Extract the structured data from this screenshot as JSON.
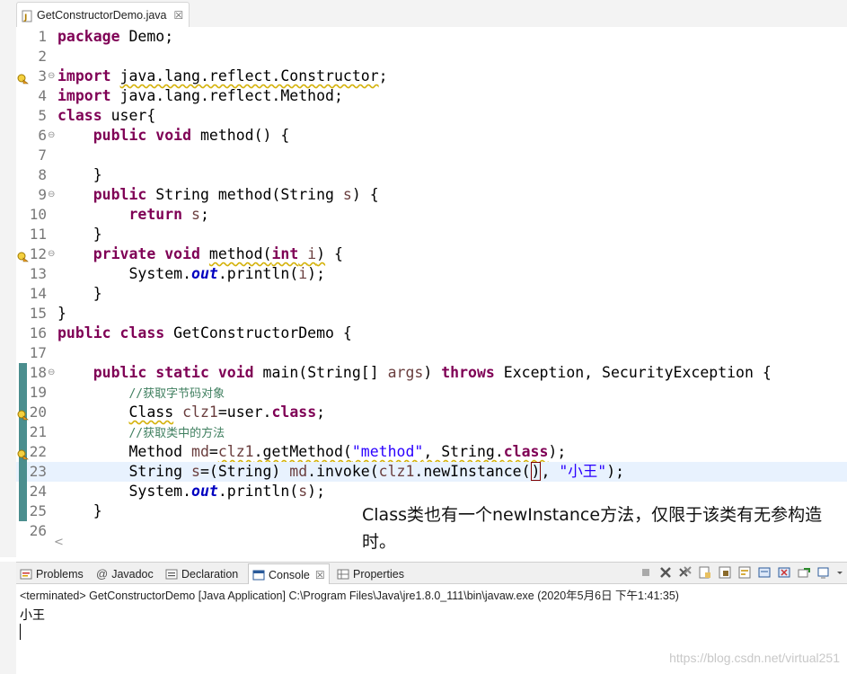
{
  "editor_tab": {
    "label": "GetConstructorDemo.java",
    "close": "☒"
  },
  "lines": [
    {
      "n": "1",
      "fold": "",
      "mark": "",
      "cur": false,
      "tokens": [
        {
          "c": "kw",
          "t": "package"
        },
        {
          "c": "",
          "t": " Demo;"
        }
      ]
    },
    {
      "n": "2",
      "fold": "",
      "mark": "",
      "cur": false,
      "tokens": []
    },
    {
      "n": "3",
      "fold": "⊖",
      "mark": "bulb",
      "cur": false,
      "tokens": [
        {
          "c": "kw",
          "t": "import"
        },
        {
          "c": "",
          "t": " "
        },
        {
          "c": "warn",
          "t": "java.lang.reflect.Constructor"
        },
        {
          "c": "",
          "t": ";"
        }
      ]
    },
    {
      "n": "4",
      "fold": "",
      "mark": "",
      "cur": false,
      "tokens": [
        {
          "c": "kw",
          "t": "import"
        },
        {
          "c": "",
          "t": " java.lang.reflect.Method;"
        }
      ]
    },
    {
      "n": "5",
      "fold": "",
      "mark": "",
      "cur": false,
      "tokens": [
        {
          "c": "kw",
          "t": "class"
        },
        {
          "c": "",
          "t": " user{"
        }
      ]
    },
    {
      "n": "6",
      "fold": "⊖",
      "mark": "",
      "cur": false,
      "tokens": [
        {
          "c": "",
          "t": "    "
        },
        {
          "c": "kw",
          "t": "public"
        },
        {
          "c": "",
          "t": " "
        },
        {
          "c": "kw",
          "t": "void"
        },
        {
          "c": "",
          "t": " method() {"
        }
      ]
    },
    {
      "n": "7",
      "fold": "",
      "mark": "",
      "cur": false,
      "tokens": []
    },
    {
      "n": "8",
      "fold": "",
      "mark": "",
      "cur": false,
      "tokens": [
        {
          "c": "",
          "t": "    }"
        }
      ]
    },
    {
      "n": "9",
      "fold": "⊖",
      "mark": "",
      "cur": false,
      "tokens": [
        {
          "c": "",
          "t": "    "
        },
        {
          "c": "kw",
          "t": "public"
        },
        {
          "c": "",
          "t": " String method(String "
        },
        {
          "c": "var",
          "t": "s"
        },
        {
          "c": "",
          "t": ") {"
        }
      ]
    },
    {
      "n": "10",
      "fold": "",
      "mark": "",
      "cur": false,
      "tokens": [
        {
          "c": "",
          "t": "        "
        },
        {
          "c": "kw",
          "t": "return"
        },
        {
          "c": "",
          "t": " "
        },
        {
          "c": "var",
          "t": "s"
        },
        {
          "c": "",
          "t": ";"
        }
      ]
    },
    {
      "n": "11",
      "fold": "",
      "mark": "",
      "cur": false,
      "tokens": [
        {
          "c": "",
          "t": "    }"
        }
      ]
    },
    {
      "n": "12",
      "fold": "⊖",
      "mark": "bulb",
      "cur": false,
      "tokens": [
        {
          "c": "",
          "t": "    "
        },
        {
          "c": "kw",
          "t": "private"
        },
        {
          "c": "",
          "t": " "
        },
        {
          "c": "kw",
          "t": "void"
        },
        {
          "c": "",
          "t": " "
        },
        {
          "c": "warn",
          "t": "method("
        },
        {
          "c": "kw warn",
          "t": "int"
        },
        {
          "c": "warn",
          "t": " "
        },
        {
          "c": "var warn",
          "t": "i"
        },
        {
          "c": "warn",
          "t": ")"
        },
        {
          "c": "",
          "t": " {"
        }
      ]
    },
    {
      "n": "13",
      "fold": "",
      "mark": "",
      "cur": false,
      "tokens": [
        {
          "c": "",
          "t": "        System."
        },
        {
          "c": "fld",
          "t": "out"
        },
        {
          "c": "",
          "t": ".println("
        },
        {
          "c": "var",
          "t": "i"
        },
        {
          "c": "",
          "t": ");"
        }
      ]
    },
    {
      "n": "14",
      "fold": "",
      "mark": "",
      "cur": false,
      "tokens": [
        {
          "c": "",
          "t": "    }"
        }
      ]
    },
    {
      "n": "15",
      "fold": "",
      "mark": "",
      "cur": false,
      "tokens": [
        {
          "c": "",
          "t": "}"
        }
      ]
    },
    {
      "n": "16",
      "fold": "",
      "mark": "",
      "cur": false,
      "tokens": [
        {
          "c": "kw",
          "t": "public"
        },
        {
          "c": "",
          "t": " "
        },
        {
          "c": "kw",
          "t": "class"
        },
        {
          "c": "",
          "t": " GetConstructorDemo {"
        }
      ]
    },
    {
      "n": "17",
      "fold": "",
      "mark": "",
      "cur": false,
      "tokens": []
    },
    {
      "n": "18",
      "fold": "⊖",
      "mark": "teal",
      "cur": false,
      "tokens": [
        {
          "c": "",
          "t": "    "
        },
        {
          "c": "kw",
          "t": "public"
        },
        {
          "c": "",
          "t": " "
        },
        {
          "c": "kw",
          "t": "static"
        },
        {
          "c": "",
          "t": " "
        },
        {
          "c": "kw",
          "t": "void"
        },
        {
          "c": "",
          "t": " main(String[] "
        },
        {
          "c": "var",
          "t": "args"
        },
        {
          "c": "",
          "t": ") "
        },
        {
          "c": "kw",
          "t": "throws"
        },
        {
          "c": "",
          "t": " Exception, SecurityException {"
        }
      ]
    },
    {
      "n": "19",
      "fold": "",
      "mark": "teal",
      "cur": false,
      "tokens": [
        {
          "c": "",
          "t": "        "
        },
        {
          "c": "cm",
          "t": "//获取字节码对象"
        }
      ]
    },
    {
      "n": "20",
      "fold": "",
      "mark": "teal bulb",
      "cur": false,
      "tokens": [
        {
          "c": "",
          "t": "        "
        },
        {
          "c": "warn",
          "t": "Class"
        },
        {
          "c": "",
          "t": " "
        },
        {
          "c": "var",
          "t": "clz1"
        },
        {
          "c": "",
          "t": "=user."
        },
        {
          "c": "kw",
          "t": "class"
        },
        {
          "c": "",
          "t": ";"
        }
      ]
    },
    {
      "n": "21",
      "fold": "",
      "mark": "teal",
      "cur": false,
      "tokens": [
        {
          "c": "",
          "t": "        "
        },
        {
          "c": "cm",
          "t": "//获取类中的方法"
        }
      ]
    },
    {
      "n": "22",
      "fold": "",
      "mark": "teal bulb",
      "cur": false,
      "tokens": [
        {
          "c": "",
          "t": "        Method "
        },
        {
          "c": "var",
          "t": "md"
        },
        {
          "c": "",
          "t": "="
        },
        {
          "c": "var warn",
          "t": "clz1"
        },
        {
          "c": "warn",
          "t": ".getMethod("
        },
        {
          "c": "str warn",
          "t": "\"method\""
        },
        {
          "c": "warn",
          "t": ", String."
        },
        {
          "c": "kw warn",
          "t": "class"
        },
        {
          "c": "",
          "t": ");"
        }
      ]
    },
    {
      "n": "23",
      "fold": "",
      "mark": "teal",
      "cur": true,
      "tokens": [
        {
          "c": "",
          "t": "        String "
        },
        {
          "c": "var",
          "t": "s"
        },
        {
          "c": "",
          "t": "=(String) "
        },
        {
          "c": "var",
          "t": "md"
        },
        {
          "c": "",
          "t": ".invoke("
        },
        {
          "c": "var",
          "t": "clz1"
        },
        {
          "c": "",
          "t": ".newInstance("
        },
        {
          "c": "caret-box",
          "t": ")"
        },
        {
          "c": "",
          "t": ", "
        },
        {
          "c": "str",
          "t": "\"小王\""
        },
        {
          "c": "",
          "t": ");"
        }
      ]
    },
    {
      "n": "24",
      "fold": "",
      "mark": "teal",
      "cur": false,
      "tokens": [
        {
          "c": "",
          "t": "        System."
        },
        {
          "c": "fld",
          "t": "out"
        },
        {
          "c": "",
          "t": ".println("
        },
        {
          "c": "var",
          "t": "s"
        },
        {
          "c": "",
          "t": ");"
        }
      ]
    },
    {
      "n": "25",
      "fold": "",
      "mark": "teal",
      "cur": false,
      "tokens": [
        {
          "c": "",
          "t": "    }"
        }
      ]
    },
    {
      "n": "26",
      "fold": "",
      "mark": "",
      "cur": false,
      "tokens": []
    }
  ],
  "hscroll_arrow": "<",
  "annotation": "Class类也有一个newInstance方法，仅限于该类有无参构造时。",
  "panel": {
    "tabs": [
      {
        "label": "Problems",
        "icon": "problems-icon",
        "active": false
      },
      {
        "label": "Javadoc",
        "icon": "javadoc-icon",
        "active": false
      },
      {
        "label": "Declaration",
        "icon": "declaration-icon",
        "active": false
      },
      {
        "label": "Console",
        "icon": "console-icon",
        "active": true,
        "close": "☒"
      },
      {
        "label": "Properties",
        "icon": "properties-icon",
        "active": false
      }
    ],
    "javadoc_glyph": "@",
    "status": "<terminated> GetConstructorDemo [Java Application] C:\\Program Files\\Java\\jre1.8.0_111\\bin\\javaw.exe (2020年5月6日 下午1:41:35)",
    "output": "小王"
  },
  "colors": {
    "keyword": "#7f0055",
    "string": "#2a00ff",
    "comment": "#3f7f5f",
    "field": "#0000c0",
    "current_line": "#e8f2fe"
  },
  "watermark": "https://blog.csdn.net/virtual251"
}
